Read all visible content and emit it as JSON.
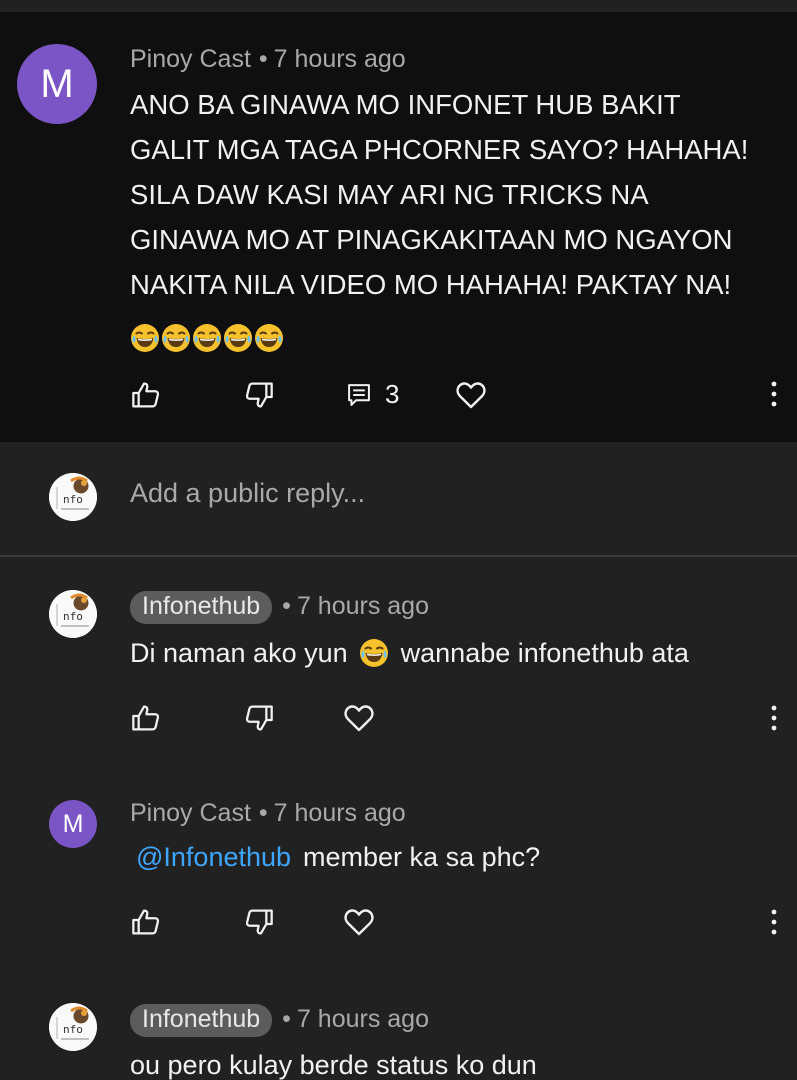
{
  "main_comment": {
    "avatar_letter": "M",
    "author": "Pinoy Cast",
    "time": "7 hours ago",
    "text_lines": [
      "ANO BA GINAWA MO INFONET HUB BAKIT",
      "GALIT MGA TAGA PHCORNER SAYO? HAHAHA!",
      "SILA DAW KASI MAY ARI NG TRICKS NA",
      "GINAWA MO AT PINAGKAKITAAN MO NGAYON",
      "NAKITA NILA VIDEO MO HAHAHA! PAKTAY NA!"
    ],
    "emoji_count": 5,
    "reply_count": "3"
  },
  "reply_box": {
    "avatar_text": "nfo",
    "placeholder": "Add a public reply..."
  },
  "replies": [
    {
      "author": "Infonethub",
      "time": "7 hours ago",
      "text_before": "Di naman ako yun",
      "text_after": "wannabe infonethub ata"
    },
    {
      "avatar_letter": "M",
      "author": "Pinoy Cast",
      "time": "7 hours ago",
      "mention": "@Infonethub",
      "text": "member ka sa phc?"
    },
    {
      "author": "Infonethub",
      "time": "7 hours ago",
      "text": "ou pero kulay berde status ko dun"
    }
  ],
  "icons": {
    "like": "thumbs-up-icon",
    "dislike": "thumbs-down-icon",
    "replies": "comment-icon",
    "heart": "heart-icon",
    "more": "more-vert-icon"
  },
  "colors": {
    "background": "#212121",
    "main_comment_background": "#0f0f0f",
    "avatar_purple": "#7b55c6",
    "mention_blue": "#3ea6ff",
    "chip_gray": "#5c5c5c"
  }
}
